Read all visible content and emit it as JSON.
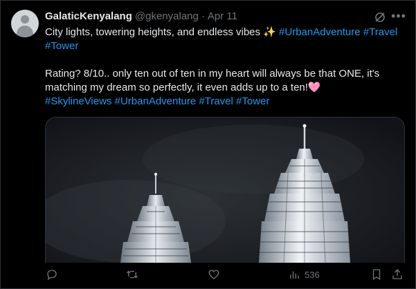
{
  "post": {
    "display_name": "GalaticKenyalang",
    "handle": "@gkenyalang",
    "separator": "·",
    "date": "Apr 11",
    "line1": "City lights, towering heights, and endless vibes ✨",
    "line1_tags": [
      "#UrbanAdventure",
      "#Travel",
      "#Tower"
    ],
    "line2_a": "Rating? 8/10.. only ten out of ten in my heart will always be that ONE, it's",
    "line2_b": "matching my dream so perfectly, it even adds up to a ten!",
    "heart_emoji": "🩷",
    "line2_tags": [
      "#SkylineViews",
      "#UrbanAdventure",
      "#Travel",
      "#Tower"
    ]
  },
  "actions": {
    "views_count": "536"
  },
  "icons": {
    "more": "more-dots-icon",
    "grok": "grok-icon",
    "reply": "reply-icon",
    "repost": "repost-icon",
    "like": "like-icon",
    "views": "views-icon",
    "bookmark": "bookmark-icon",
    "share": "share-icon"
  },
  "colors": {
    "background": "#000000",
    "text": "#e7e9ea",
    "muted": "#71767b",
    "link": "#1d9bf0"
  }
}
